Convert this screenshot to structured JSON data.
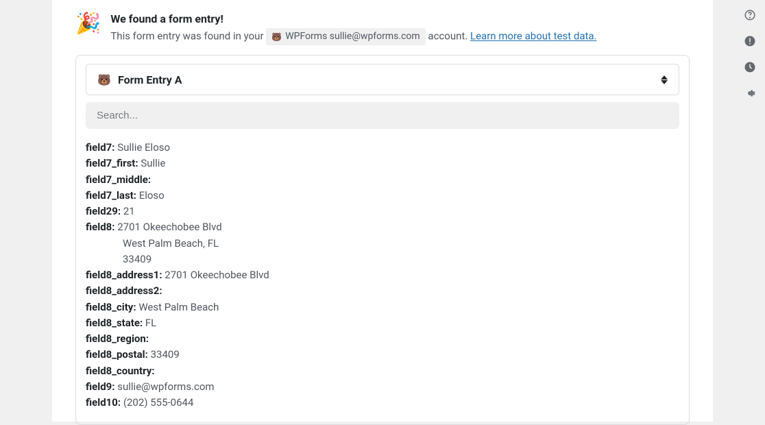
{
  "header": {
    "title": "We found a form entry!",
    "subtitle_prefix": "This form entry was found in your",
    "account_text": "WPForms sullie@wpforms.com",
    "subtitle_suffix": "account.",
    "learn_more": "Learn more about test data."
  },
  "dropdown": {
    "selected": "Form Entry A"
  },
  "search": {
    "placeholder": "Search..."
  },
  "fields": {
    "f7_key": "field7:",
    "f7_val": "Sullie Eloso",
    "f7first_key": "field7_first:",
    "f7first_val": "Sullie",
    "f7middle_key": "field7_middle:",
    "f7middle_val": "",
    "f7last_key": "field7_last:",
    "f7last_val": "Eloso",
    "f29_key": "field29:",
    "f29_val": "21",
    "f8_key": "field8:",
    "f8_line1": "2701 Okeechobee Blvd",
    "f8_line2": "West Palm Beach, FL",
    "f8_line3": "33409",
    "f8addr1_key": "field8_address1:",
    "f8addr1_val": "2701 Okeechobee Blvd",
    "f8addr2_key": "field8_address2:",
    "f8addr2_val": "",
    "f8city_key": "field8_city:",
    "f8city_val": "West Palm Beach",
    "f8state_key": "field8_state:",
    "f8state_val": "FL",
    "f8region_key": "field8_region:",
    "f8region_val": "",
    "f8postal_key": "field8_postal:",
    "f8postal_val": "33409",
    "f8country_key": "field8_country:",
    "f8country_val": "",
    "f9_key": "field9:",
    "f9_val": "sullie@wpforms.com",
    "f10_key": "field10:",
    "f10_val": "(202) 555-0644"
  }
}
